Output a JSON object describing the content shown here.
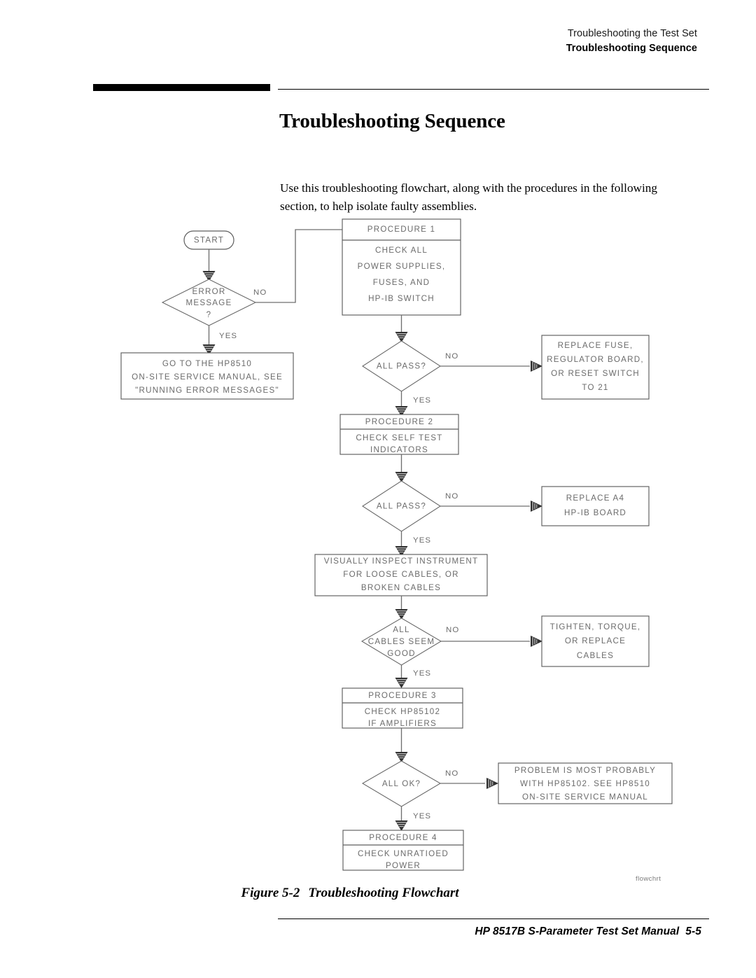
{
  "header": {
    "line1": "Troubleshooting the Test Set",
    "line2": "Troubleshooting Sequence"
  },
  "title": "Troubleshooting Sequence",
  "intro": "Use this troubleshooting flowchart, along with the procedures in the following section, to help isolate faulty assemblies.",
  "figure": {
    "number": "Figure 5-2",
    "caption": "Troubleshooting Flowchart",
    "credit": "flowchrt"
  },
  "footer": {
    "manual": "HP 8517B S-Parameter Test Set Manual",
    "page": "5-5"
  },
  "flowchart": {
    "nodes": {
      "start": {
        "label": "START",
        "shape": "terminator"
      },
      "error_message": {
        "line1": "ERROR",
        "line2": "MESSAGE",
        "line3": "?",
        "shape": "decision"
      },
      "goto_8510": {
        "line1": "GO TO THE HP8510",
        "line2": "ON-SITE SERVICE MANUAL, SEE",
        "line3": "\"RUNNING ERROR MESSAGES\"",
        "shape": "process"
      },
      "procedure_1": {
        "title": "PROCEDURE 1",
        "line1": "CHECK ALL",
        "line2": "POWER SUPPLIES,",
        "line3": "FUSES, AND",
        "line4": "HP-IB SWITCH",
        "shape": "process-titled"
      },
      "all_pass_1": {
        "line1": "ALL PASS?",
        "shape": "decision"
      },
      "replace_fuse": {
        "line1": "REPLACE FUSE,",
        "line2": "REGULATOR BOARD,",
        "line3": "OR RESET SWITCH",
        "line4": "TO 21",
        "shape": "process"
      },
      "procedure_2": {
        "title": "PROCEDURE 2",
        "line1": "CHECK SELF TEST",
        "line2": "INDICATORS",
        "shape": "process-titled"
      },
      "all_pass_2": {
        "line1": "ALL PASS?",
        "shape": "decision"
      },
      "replace_a4": {
        "line1": "REPLACE A4",
        "line2": "HP-IB BOARD",
        "shape": "process"
      },
      "visual_inspect": {
        "line1": "VISUALLY INSPECT INSTRUMENT",
        "line2": "FOR LOOSE CABLES, OR",
        "line3": "BROKEN CABLES",
        "shape": "process"
      },
      "cables_good": {
        "line1": "ALL",
        "line2": "CABLES SEEM",
        "line3": "GOOD",
        "shape": "decision"
      },
      "tighten_cables": {
        "line1": "TIGHTEN, TORQUE,",
        "line2": "OR REPLACE",
        "line3": "CABLES",
        "shape": "process"
      },
      "procedure_3": {
        "title": "PROCEDURE 3",
        "line1": "CHECK HP85102",
        "line2": "IF AMPLIFIERS",
        "shape": "process-titled"
      },
      "all_ok": {
        "line1": "ALL OK?",
        "shape": "decision"
      },
      "problem_85102": {
        "line1": "PROBLEM IS MOST PROBABLY",
        "line2": "WITH HP85102. SEE HP8510",
        "line3": "ON-SITE SERVICE MANUAL",
        "shape": "process"
      },
      "procedure_4": {
        "title": "PROCEDURE 4",
        "line1": "CHECK UNRATIOED",
        "line2": "POWER",
        "shape": "process-titled"
      }
    },
    "branch_labels": {
      "error_no": "NO",
      "error_yes": "YES",
      "pass1_no": "NO",
      "pass1_yes": "YES",
      "pass2_no": "NO",
      "pass2_yes": "YES",
      "cables_no": "NO",
      "cables_yes": "YES",
      "ok_no": "NO",
      "ok_yes": "YES"
    }
  }
}
